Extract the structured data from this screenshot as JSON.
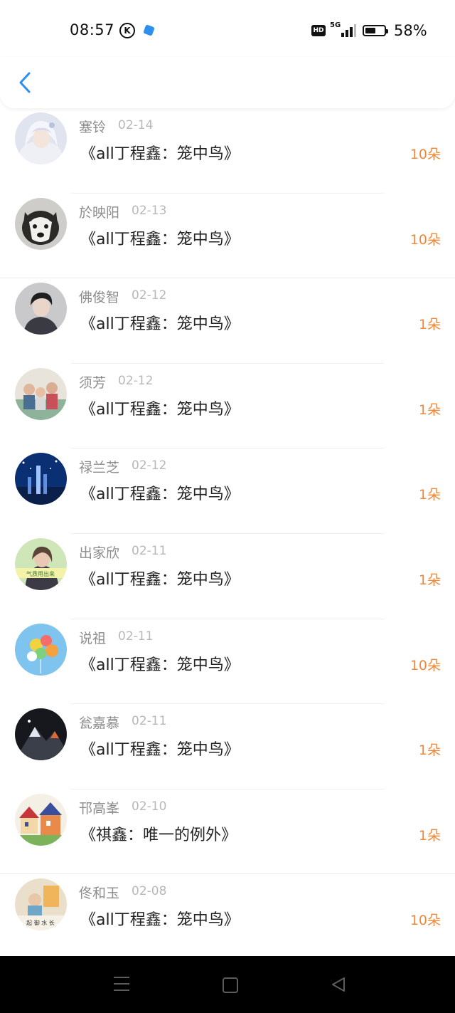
{
  "status_bar": {
    "time": "08:57",
    "k_icon_label": "K",
    "hd_label": "HD",
    "network_label": "5G",
    "battery_percent_text": "58%",
    "battery_level": 0.58
  },
  "colors": {
    "accent_blue": "#2d8ff0",
    "flower_orange": "#f0883a",
    "name_gray": "#8d8d8d",
    "date_gray": "#b8b8b8"
  },
  "header": {
    "back_icon": "chevron-left-icon"
  },
  "records": [
    {
      "name": "塞铃",
      "date": "02-14",
      "title": "《all丁程鑫：笼中鸟》",
      "flowers": "10朵"
    },
    {
      "name": "於映阳",
      "date": "02-13",
      "title": "《all丁程鑫：笼中鸟》",
      "flowers": "10朵"
    },
    {
      "name": "佛俊智",
      "date": "02-12",
      "title": "《all丁程鑫：笼中鸟》",
      "flowers": "1朵"
    },
    {
      "name": "须芳",
      "date": "02-12",
      "title": "《all丁程鑫：笼中鸟》",
      "flowers": "1朵"
    },
    {
      "name": "禄兰芝",
      "date": "02-12",
      "title": "《all丁程鑫：笼中鸟》",
      "flowers": "1朵"
    },
    {
      "name": "出家欣",
      "date": "02-11",
      "title": "《all丁程鑫：笼中鸟》",
      "flowers": "1朵"
    },
    {
      "name": "说祖",
      "date": "02-11",
      "title": "《all丁程鑫：笼中鸟》",
      "flowers": "10朵"
    },
    {
      "name": "瓮嘉慕",
      "date": "02-11",
      "title": "《all丁程鑫：笼中鸟》",
      "flowers": "1朵"
    },
    {
      "name": "邗高峯",
      "date": "02-10",
      "title": "《祺鑫：唯一的例外》",
      "flowers": "1朵"
    },
    {
      "name": "佟和玉",
      "date": "02-08",
      "title": "《all丁程鑫：笼中鸟》",
      "flowers": "10朵"
    }
  ],
  "avatar_badges": {
    "avatar_6": "气质用出来",
    "avatar_10": "起 御 水 长"
  },
  "nav_bar": {
    "menu_icon": "menu-icon",
    "home_icon": "home-icon",
    "back_icon": "back-triangle-icon"
  }
}
